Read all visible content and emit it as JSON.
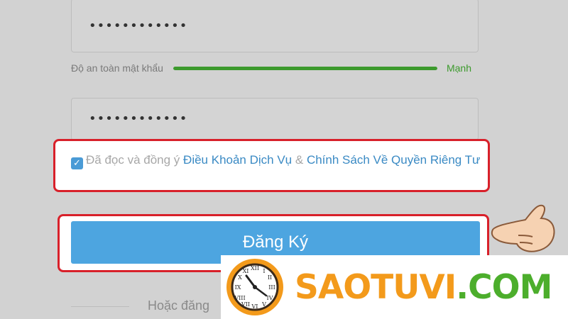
{
  "form": {
    "password_value": "••••••••••••",
    "confirm_password_value": "••••••••••••",
    "strength_label": "Độ an toàn mật khẩu",
    "strength_value": "Mạnh",
    "strength_fraction": 1.0,
    "terms_prefix": "Đã đọc và đồng ý",
    "terms_link": "Điều Khoản Dịch Vụ",
    "terms_ampersand": "&",
    "privacy_link": "Chính Sách Về Quyền Riêng Tư",
    "register_label": "Đăng Ký",
    "alt_signup_text": "Hoặc đăng",
    "checkbox_checked": true
  },
  "watermark": {
    "brand_part1": "SAOTUVI",
    "brand_part2": ".COM"
  },
  "colors": {
    "accent_blue": "#4da5e0",
    "strength_green": "#3c9a2d",
    "highlight_red": "#d8202a",
    "brand_orange": "#f39a1b",
    "brand_green": "#4cae2c"
  },
  "icons": {
    "checkbox": "check-icon",
    "pointer": "pointing-hand-icon",
    "logo": "clock-logo-icon"
  }
}
